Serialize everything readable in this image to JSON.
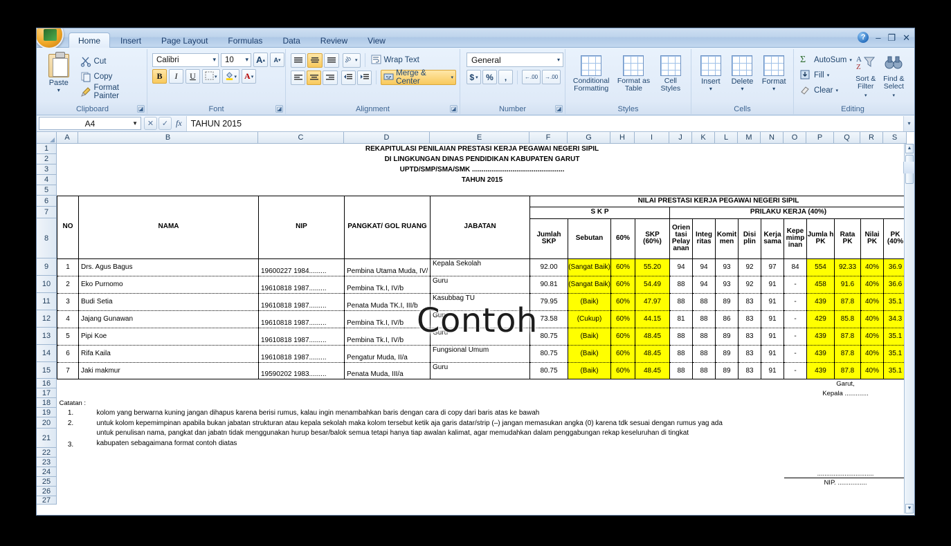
{
  "window": {
    "office_button": "office-orb",
    "help": "?",
    "minimize": "–",
    "restore": "❐",
    "close": "✕"
  },
  "ribbon": {
    "tabs": [
      {
        "label": "Home",
        "active": true
      },
      {
        "label": "Insert",
        "active": false
      },
      {
        "label": "Page Layout",
        "active": false
      },
      {
        "label": "Formulas",
        "active": false
      },
      {
        "label": "Data",
        "active": false
      },
      {
        "label": "Review",
        "active": false
      },
      {
        "label": "View",
        "active": false
      }
    ],
    "groups": {
      "clipboard": {
        "name": "Clipboard",
        "paste": "Paste",
        "cut": "Cut",
        "copy": "Copy",
        "format_painter": "Format Painter"
      },
      "font": {
        "name": "Font",
        "family": "Calibri",
        "size": "10",
        "grow": "A",
        "shrink": "A",
        "bold": "B",
        "italic": "I",
        "underline": "U",
        "borders": "borders-icon",
        "fill": "A",
        "color": "A"
      },
      "alignment": {
        "name": "Alignment",
        "wrap_text": "Wrap Text",
        "merge_center": "Merge & Center",
        "orientation": "orientation-icon",
        "indent_decrease": "decrease-indent-icon",
        "indent_increase": "increase-indent-icon"
      },
      "number": {
        "name": "Number",
        "format": "General",
        "currency": "$",
        "percent": "%",
        "comma": ",",
        "increase_decimal": ".00",
        "decrease_decimal": ".00"
      },
      "styles": {
        "name": "Styles",
        "conditional_formatting": "Conditional Formatting",
        "format_as_table": "Format as Table",
        "cell_styles": "Cell Styles"
      },
      "cells": {
        "name": "Cells",
        "insert": "Insert",
        "delete": "Delete",
        "format": "Format"
      },
      "editing": {
        "name": "Editing",
        "autosum": "AutoSum",
        "fill": "Fill",
        "clear": "Clear",
        "sort_filter": "Sort & Filter",
        "find_select": "Find & Select"
      }
    }
  },
  "formula_bar": {
    "name_box": "A4",
    "fx": "fx",
    "content": "TAHUN 2015"
  },
  "grid": {
    "columns": [
      "A",
      "B",
      "C",
      "D",
      "E",
      "F",
      "G",
      "H",
      "I",
      "J",
      "K",
      "L",
      "M",
      "N",
      "O",
      "P",
      "Q",
      "R",
      "S"
    ],
    "rows": [
      "1",
      "2",
      "3",
      "4",
      "5",
      "6",
      "7",
      "8",
      "9",
      "10",
      "11",
      "12",
      "13",
      "14",
      "15",
      "16",
      "17",
      "18",
      "19",
      "20",
      "21",
      "22",
      "23",
      "24",
      "25",
      "26",
      "27"
    ]
  },
  "sheet": {
    "title_lines": [
      "REKAPITULASI PENILAIAN PRESTASI KERJA PEGAWAI NEGERI SIPIL",
      "DI LINGKUNGAN DINAS PENDIDIKAN KABUPATEN GARUT",
      "UPTD/SMP/SMA/SMK ................................................",
      "TAHUN 2015"
    ],
    "header": {
      "no": "NO",
      "nama": "NAMA",
      "nip": "NIP",
      "pangkat": "PANGKAT/ GOL RUANG",
      "jabatan": "JABATAN",
      "group_main": "NILAI PRESTASI KERJA PEGAWAI NEGERI SIPIL",
      "group_skp": "S K P",
      "group_prilaku": "PRILAKU KERJA (40%)",
      "sub": [
        "Jumlah SKP",
        "Sebutan",
        "60%",
        "SKP (60%)",
        "Orien tasi Pelay anan",
        "Integ ritas",
        "Komit men",
        "Disi plin",
        "Kerja sama",
        "Kepe mimp inan",
        "Jumla h PK",
        "Rata PK",
        "Nilai PK",
        "PK (40%"
      ]
    },
    "rows": [
      {
        "no": "1",
        "nama": "Drs. Agus Bagus",
        "nip": "19600227 1984.........",
        "pangkat": "Pembina Utama Muda, IV/",
        "jabatan": "Kepala Sekolah",
        "jumlah_skp": "92.00",
        "sebutan": "(Sangat Baik)",
        "p60": "60%",
        "skp60": "55.20",
        "orientasi": "94",
        "integritas": "94",
        "komitmen": "93",
        "disiplin": "92",
        "kerjasama": "97",
        "kepemimpinan": "84",
        "jumlah_pk": "554",
        "rata_pk": "92.33",
        "nilai_pk": "40%",
        "pk40": "36.9"
      },
      {
        "no": "2",
        "nama": "Eko Purnomo",
        "nip": "19610818 1987.........",
        "pangkat": "Pembina Tk.I, IV/b",
        "jabatan": "Guru",
        "jumlah_skp": "90.81",
        "sebutan": "(Sangat Baik)",
        "p60": "60%",
        "skp60": "54.49",
        "orientasi": "88",
        "integritas": "94",
        "komitmen": "93",
        "disiplin": "92",
        "kerjasama": "91",
        "kepemimpinan": "-",
        "jumlah_pk": "458",
        "rata_pk": "91.6",
        "nilai_pk": "40%",
        "pk40": "36.6"
      },
      {
        "no": "3",
        "nama": "Budi Setia",
        "nip": "19610818 1987.........",
        "pangkat": "Penata Muda TK.I, III/b",
        "jabatan": "Kasubbag TU",
        "jumlah_skp": "79.95",
        "sebutan": "(Baik)",
        "p60": "60%",
        "skp60": "47.97",
        "orientasi": "88",
        "integritas": "88",
        "komitmen": "89",
        "disiplin": "83",
        "kerjasama": "91",
        "kepemimpinan": "-",
        "jumlah_pk": "439",
        "rata_pk": "87.8",
        "nilai_pk": "40%",
        "pk40": "35.1"
      },
      {
        "no": "4",
        "nama": "Jajang Gunawan",
        "nip": "19610818 1987.........",
        "pangkat": "Pembina Tk.I, IV/b",
        "jabatan": "Guru",
        "jumlah_skp": "73.58",
        "sebutan": "(Cukup)",
        "p60": "60%",
        "skp60": "44.15",
        "orientasi": "81",
        "integritas": "88",
        "komitmen": "86",
        "disiplin": "83",
        "kerjasama": "91",
        "kepemimpinan": "-",
        "jumlah_pk": "429",
        "rata_pk": "85.8",
        "nilai_pk": "40%",
        "pk40": "34.3"
      },
      {
        "no": "5",
        "nama": "Pipi Koe",
        "nip": "19610818 1987.........",
        "pangkat": "Pembina Tk.I, IV/b",
        "jabatan": "Guru",
        "jumlah_skp": "80.75",
        "sebutan": "(Baik)",
        "p60": "60%",
        "skp60": "48.45",
        "orientasi": "88",
        "integritas": "88",
        "komitmen": "89",
        "disiplin": "83",
        "kerjasama": "91",
        "kepemimpinan": "-",
        "jumlah_pk": "439",
        "rata_pk": "87.8",
        "nilai_pk": "40%",
        "pk40": "35.1"
      },
      {
        "no": "6",
        "nama": "Rifa Kaila",
        "nip": "19610818 1987.........",
        "pangkat": "Pengatur Muda, II/a",
        "jabatan": "Fungsional Umum",
        "jumlah_skp": "80.75",
        "sebutan": "(Baik)",
        "p60": "60%",
        "skp60": "48.45",
        "orientasi": "88",
        "integritas": "88",
        "komitmen": "89",
        "disiplin": "83",
        "kerjasama": "91",
        "kepemimpinan": "-",
        "jumlah_pk": "439",
        "rata_pk": "87.8",
        "nilai_pk": "40%",
        "pk40": "35.1"
      },
      {
        "no": "7",
        "nama": "Jaki makmur",
        "nip": "19590202 1983.........",
        "pangkat": "Penata Muda, III/a",
        "jabatan": "Guru",
        "jumlah_skp": "80.75",
        "sebutan": "(Baik)",
        "p60": "60%",
        "skp60": "48.45",
        "orientasi": "88",
        "integritas": "88",
        "komitmen": "89",
        "disiplin": "83",
        "kerjasama": "91",
        "kepemimpinan": "-",
        "jumlah_pk": "439",
        "rata_pk": "87.8",
        "nilai_pk": "40%",
        "pk40": "35.1"
      }
    ],
    "notes": {
      "label": "Catatan :",
      "items": [
        {
          "num": "1.",
          "text": "kolom yang berwarna kuning jangan dihapus karena berisi rumus, kalau ingin menambahkan baris dengan cara di copy dari baris atas ke bawah"
        },
        {
          "num": "2.",
          "text": "untuk kolom kepemimpinan apabila bukan jabatan strukturan atau kepala sekolah maka kolom tersebut ketik aja garis datar/strip (–) jangan memasukan angka (0) karena tdk sesuai dengan rumus yag ada"
        },
        {
          "num": "3.",
          "text": "untuk penulisan nama, pangkat dan jabatn tidak menggunakan hurup besar/balok semua tetapi hanya tiap awalan kalimat, agar memudahkan dalam penggabungan rekap keseluruhan di tingkat"
        },
        {
          "num": "",
          "text": "kabupaten sebagaimana format contoh diatas"
        }
      ]
    },
    "signature": {
      "place": "Garut,",
      "title": "Kepala .............",
      "line": "...............................",
      "nip": "NIP. ................"
    },
    "watermark": "Contoh"
  }
}
